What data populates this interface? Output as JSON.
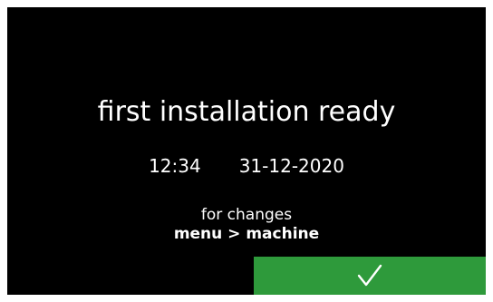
{
  "screen": {
    "title": "first installation ready",
    "time": "12:34",
    "date": "31-12-2020",
    "hint_line": "for changes",
    "menu_path": "menu > machine"
  },
  "confirm_button": {
    "icon": "checkmark-icon",
    "color": "#2e9a3b"
  },
  "colors": {
    "background": "#000000",
    "text": "#ffffff"
  }
}
